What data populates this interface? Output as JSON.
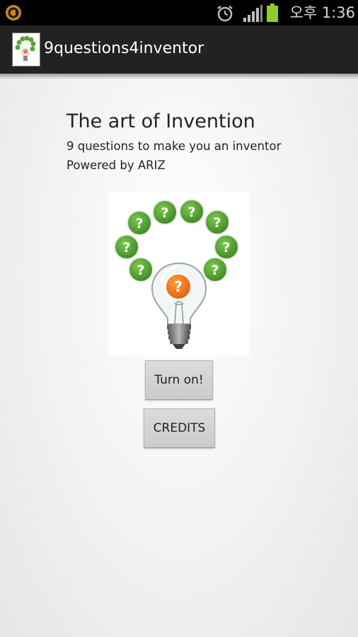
{
  "status_bar": {
    "time": "오후 1:36",
    "icons": [
      "notification-icon",
      "alarm-icon",
      "signal-icon",
      "battery-icon"
    ],
    "battery_color": "#8ccf28"
  },
  "action_bar": {
    "title": "9questions4inventor",
    "icon": "lightbulb-logo-icon"
  },
  "main": {
    "headline": "The art of Invention",
    "subtitle": "9 questions to make you an inventor",
    "powered_by": "Powered by ARIZ",
    "logo": {
      "question_mark": "?",
      "bubble_color": "#5aa33a",
      "center_color": "#ee7a22"
    },
    "buttons": {
      "turn_on": "Turn on!",
      "credits": "CREDITS"
    }
  }
}
